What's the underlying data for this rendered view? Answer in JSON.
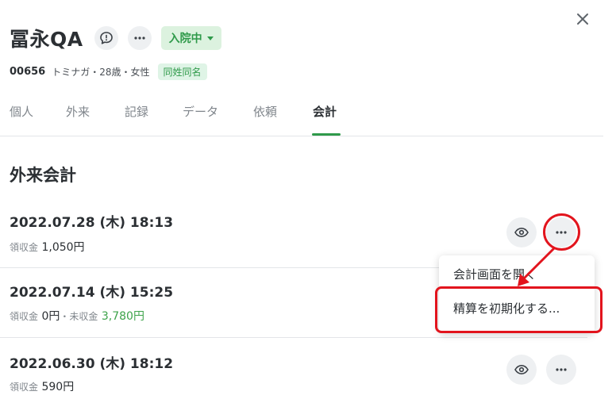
{
  "patient": {
    "name": "冨永QA",
    "status": "入院中",
    "id": "00656",
    "kana_info": "トミナガ・28歳・女性",
    "same_name_badge": "同姓同名"
  },
  "tabs": [
    {
      "label": "個人",
      "active": false
    },
    {
      "label": "外来",
      "active": false
    },
    {
      "label": "記録",
      "active": false
    },
    {
      "label": "データ",
      "active": false
    },
    {
      "label": "依頼",
      "active": false
    },
    {
      "label": "会計",
      "active": true
    }
  ],
  "section_title": "外来会計",
  "visits": [
    {
      "datetime": "2022.07.28 (木) 18:13",
      "received_label": "領収金",
      "received_amount": "1,050円"
    },
    {
      "datetime": "2022.07.14 (木) 15:25",
      "received_label": "領収金",
      "received_amount": "0円",
      "separator": "・",
      "unpaid_label": "未収金",
      "unpaid_amount": "3,780円"
    },
    {
      "datetime": "2022.06.30 (木) 18:12",
      "received_label": "領収金",
      "received_amount": "590円"
    }
  ],
  "context_menu": {
    "items": [
      "会計画面を開く",
      "精算を初期化する..."
    ]
  },
  "icons": {
    "close": "close-icon",
    "alert": "alert-icon",
    "more": "more-horizontal-icon",
    "view": "eye-icon"
  },
  "colors": {
    "accent_green": "#2f9a4a",
    "status_badge_bg": "#dcf2df",
    "annotation_red": "#e2141d"
  }
}
